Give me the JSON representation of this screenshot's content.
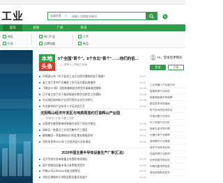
{
  "header": {
    "logo": "工业",
    "search": {
      "scope": "全部信息",
      "placeholder": "请输入您需要关键词"
    },
    "phone": "",
    "colors": {
      "brand": "#2e9c48",
      "accent": "#d93a2b"
    }
  },
  "nav": {
    "items": [
      {
        "label": "首页"
      },
      {
        "label": "招商"
      },
      {
        "label": "厂商"
      },
      {
        "label": "资讯"
      }
    ]
  },
  "subnav": {
    "col1": [
      "地区",
      "行业"
    ],
    "col2": [
      "热门产品",
      "品牌加盟"
    ],
    "col3": [
      "二手",
      "新品"
    ]
  },
  "headline": {
    "tag_top": "本地",
    "tag_bottom": "头条",
    "title": "5个全国“首个”、8个东北“首个”……他们的低...",
    "sub": "—— 发布于 | 中国工业网"
  },
  "news": [
    {
      "text": "环境部公布《关于促进工业企业提质增效的若干措施》",
      "date": "03-07"
    },
    {
      "text": "省工信厅发布产业集群三年行动方案实施细则",
      "date": "03-07"
    },
    {
      "text": "【微论ST表】沈阳装备制造业转型升级新路径解析",
      "date": "03-06"
    },
    {
      "text": "辽宁省工信厅关于推进制造业数字化转型工作通知",
      "date": "03-06"
    },
    {
      "text": "东北地区新材料产业项目签约仪式在沈举行",
      "date": "03-06"
    },
    {
      "text": "东北新材料产业技术人才培训会召开",
      "date": "03-05"
    }
  ],
  "mid": {
    "title": "沈阳辉山经济开发区与地质局签约打造辉山产业园",
    "sub": "—— 本报讯 | 记者 中国工业网"
  },
  "news2": [
    {
      "text": "全国首台套智能电网装备在沈阳下线交付使用",
      "date": "03-05"
    },
    {
      "text": "高新区一批重点工业项目集中开工建设",
      "date": "03-05"
    },
    {
      "text": "鞍钢集团一季度钢材出口同比增长数据发布",
      "date": "03-04"
    },
    {
      "text": "沈阳市发布2020年工业经济运行分析报告",
      "date": "03-04"
    },
    {
      "text": "辽宁省“专精特新”中小企业认定工作启动",
      "date": "03-04"
    }
  ],
  "section": {
    "title": "2020中国主要半导体设备生产厂家(汇总)"
  },
  "news3": [
    {
      "text": "北方华创半导体装备业务营收持续增长",
      "date": "03-03"
    },
    {
      "text": "国产刻蚀机设备市场占有率稳步提升",
      "date": "03-03"
    },
    {
      "text": "中微公司公布2020年度业绩预告",
      "date": "03-02"
    },
    {
      "text": "沈阳芯源微电子涂胶显影设备实现量产",
      "date": "03-02"
    },
    {
      "text": "盛美半导体清洗设备进入国际主流产线",
      "date": "03-01"
    }
  ],
  "sidebar": {
    "greet": "Hi，登录后更精彩",
    "login": "登录",
    "register": "注册",
    "items": [
      "工业机器人产业链分析",
      "智能制造行业动态",
      "新能源装备市场观察",
      "数控机床采购指南",
      "电气自动化技术前沿",
      "环保设备行业资讯",
      "化工机械行业分析",
      "轴承五金市场行情",
      "仪器仪表产品推荐",
      "泵阀管件行业报道",
      "液压气动技术应用",
      "包装机械行业新闻",
      "纺织机械市场动态",
      "印刷设备采购信息",
      "食品机械新品发布"
    ]
  },
  "banner": {
    "caption": ""
  }
}
